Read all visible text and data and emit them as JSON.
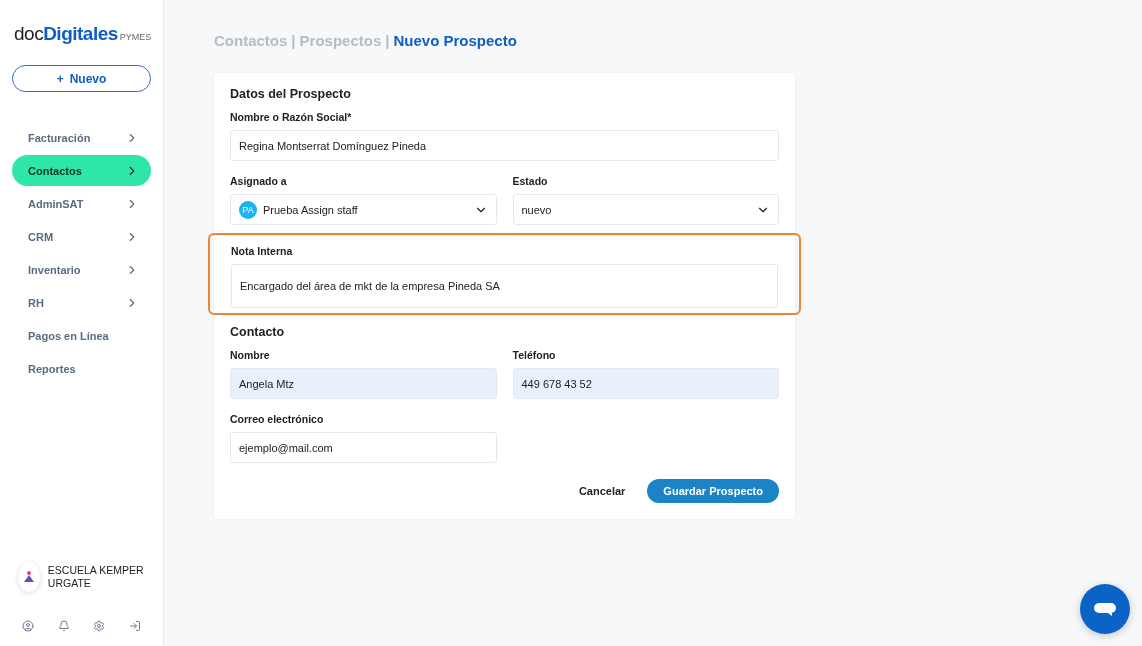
{
  "sidebar": {
    "logo": {
      "prefix": "doc",
      "brand": "Digitales",
      "suffix": "PYMES"
    },
    "new_button": {
      "icon": "+",
      "label": "Nuevo"
    },
    "items": [
      {
        "label": "Facturación",
        "selected": false,
        "has_children": true
      },
      {
        "label": "Contactos",
        "selected": true,
        "has_children": true
      },
      {
        "label": "AdminSAT",
        "selected": false,
        "has_children": true
      },
      {
        "label": "CRM",
        "selected": false,
        "has_children": true
      },
      {
        "label": "Inventario",
        "selected": false,
        "has_children": true
      },
      {
        "label": "RH",
        "selected": false,
        "has_children": true
      },
      {
        "label": "Pagos en Línea",
        "selected": false,
        "has_children": false
      },
      {
        "label": "Reportes",
        "selected": false,
        "has_children": false
      }
    ],
    "account": {
      "name": "ESCUELA KEMPER URGATE"
    },
    "footer_icons": [
      {
        "kind": "profile"
      },
      {
        "kind": "notifications"
      },
      {
        "kind": "settings"
      },
      {
        "kind": "logout"
      }
    ]
  },
  "breadcrumb": [
    {
      "label": "Contactos",
      "selected": false
    },
    {
      "separator": "|",
      "label": "Prospectos",
      "selected": false
    },
    {
      "separator": "|",
      "label": "Nuevo Prospecto",
      "selected": true
    }
  ],
  "form": {
    "title": "Datos del Prospecto",
    "name_field": {
      "label": "Nombre o Razón Social*",
      "value": "Regina Montserrat Domínguez Pineda"
    },
    "assigned": {
      "label": "Asignado a",
      "initials": "PA",
      "value": "Prueba Assign staff"
    },
    "status": {
      "label": "Estado",
      "value": "nuevo"
    },
    "note": {
      "label": "Nota Interna",
      "value": "Encargado del área de mkt de la empresa Pineda SA",
      "highlighted": true
    },
    "contact_title": "Contacto",
    "contact_fields": [
      {
        "label": "Nombre",
        "value": "Angela Mtz",
        "autofilled": true
      },
      {
        "label": "Teléfono",
        "value": "449 678 43 52",
        "autofilled": true
      },
      {
        "label": "Correo electrónico",
        "value": "ejemplo@mail.com",
        "autofilled": false
      }
    ],
    "cancel": "Cancelar",
    "save": "Guardar Prospecto"
  }
}
